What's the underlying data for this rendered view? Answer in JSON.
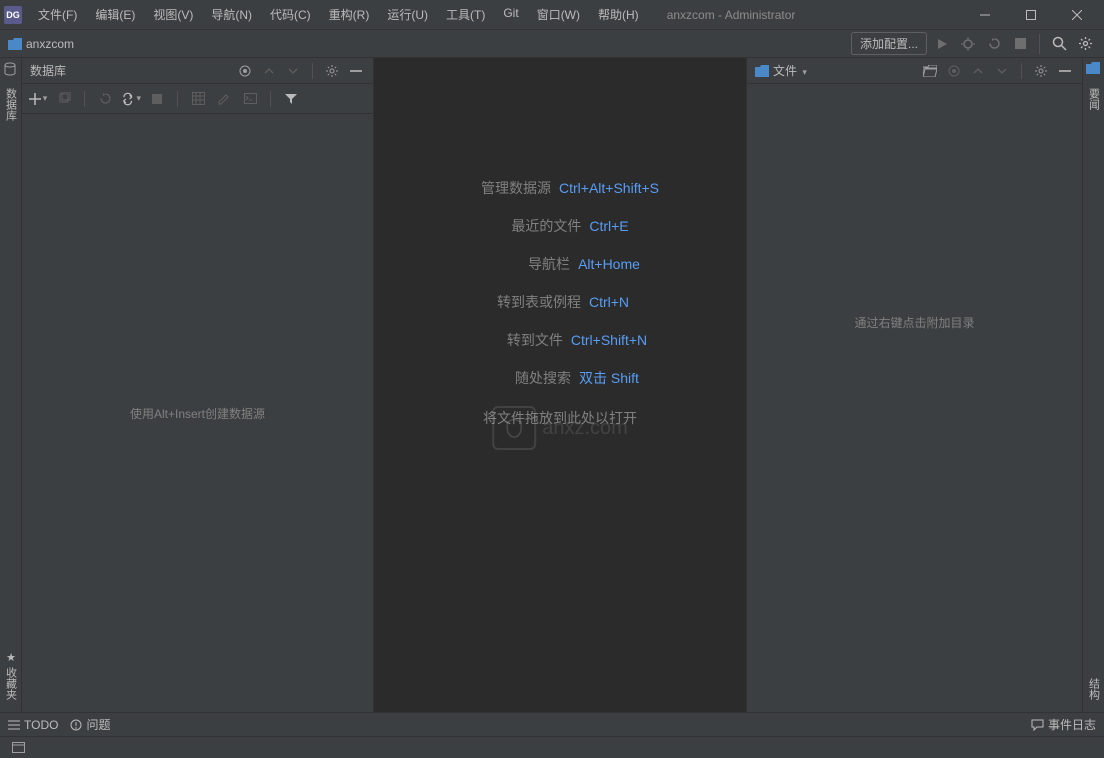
{
  "titlebar": {
    "app_icon_text": "DG",
    "title": "anxzcom - Administrator",
    "menu": [
      "文件(F)",
      "编辑(E)",
      "视图(V)",
      "导航(N)",
      "代码(C)",
      "重构(R)",
      "运行(U)",
      "工具(T)",
      "Git",
      "窗口(W)",
      "帮助(H)"
    ]
  },
  "toolbar": {
    "project_name": "anxzcom",
    "add_config": "添加配置..."
  },
  "left_panel": {
    "title": "数据库",
    "hint": "使用Alt+Insert创建数据源"
  },
  "left_gutter": {
    "tab1": "数据库",
    "tab_bottom": "收藏夹"
  },
  "editor": {
    "shortcuts": [
      {
        "label": "管理数据源",
        "key": "Ctrl+Alt+Shift+S"
      },
      {
        "label": "最近的文件",
        "key": "Ctrl+E"
      },
      {
        "label": "导航栏",
        "key": "Alt+Home"
      },
      {
        "label": "转到表或例程",
        "key": "Ctrl+N"
      },
      {
        "label": "转到文件",
        "key": "Ctrl+Shift+N"
      },
      {
        "label": "随处搜索",
        "key": "双击 Shift"
      }
    ],
    "drop_hint": "将文件拖放到此处以打开",
    "watermark_text": "anxz.com"
  },
  "right_panel": {
    "title": "文件",
    "hint": "通过右键点击附加目录"
  },
  "right_gutter": {
    "tab1": "要闻",
    "tab_bottom": "结构"
  },
  "bottom": {
    "todo": "TODO",
    "problems": "问题",
    "event_log": "事件日志"
  }
}
